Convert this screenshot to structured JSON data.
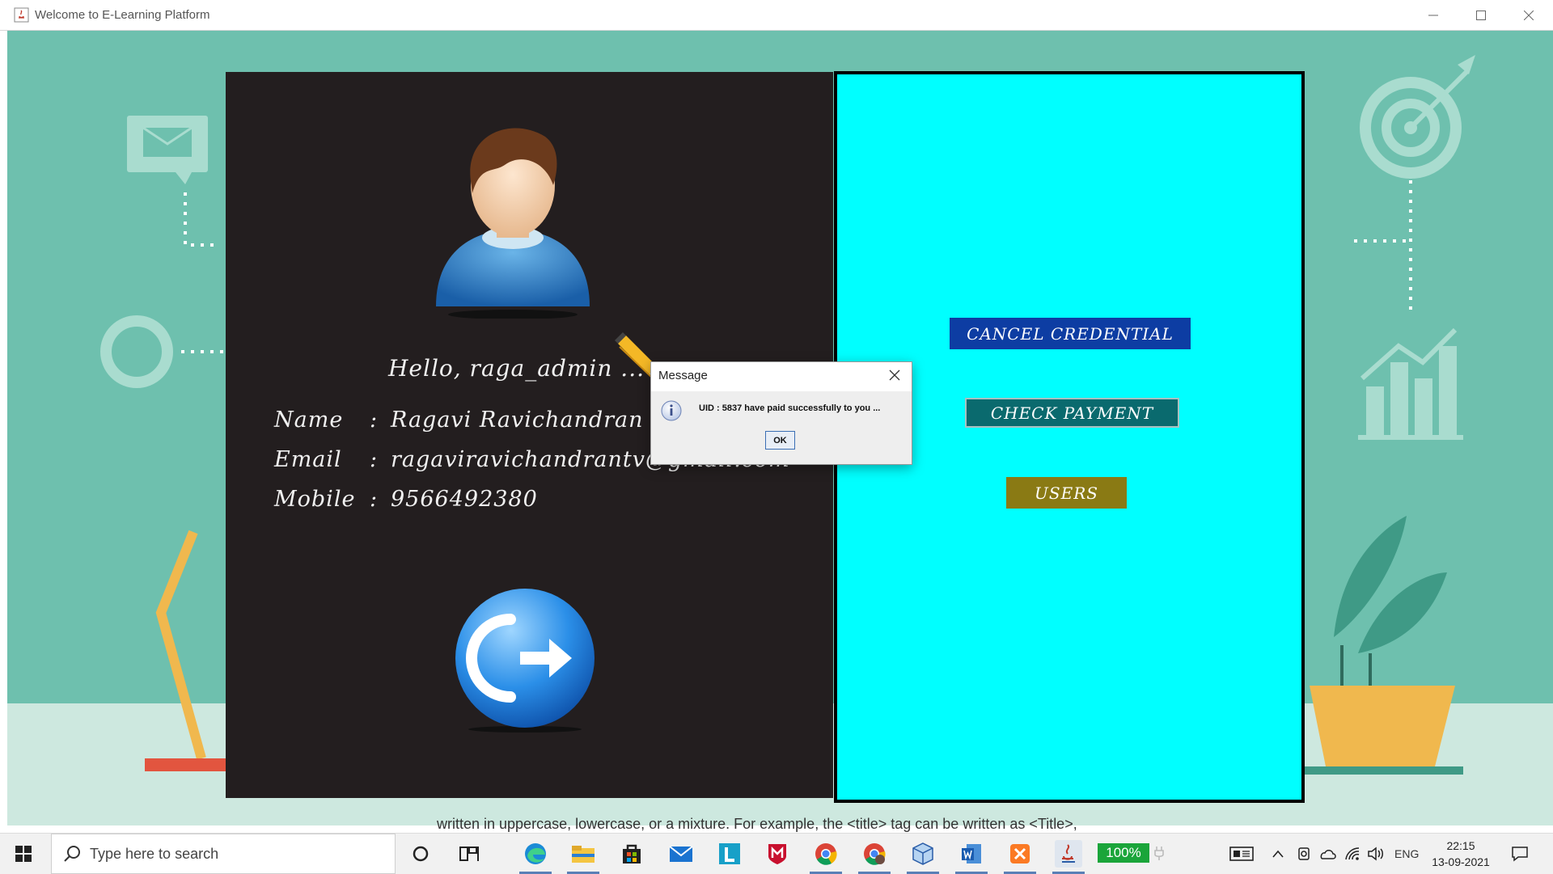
{
  "window": {
    "title": "Welcome to E-Learning Platform",
    "controls": [
      "minimize",
      "maximize",
      "close"
    ]
  },
  "profile": {
    "greeting": "Hello, raga_admin ...",
    "name_label": "Name",
    "name_value": "Ragavi Ravichandran",
    "email_label": "Email",
    "email_value": "ragaviravichandrantv@gmail.com",
    "mobile_label": "Mobile",
    "mobile_value": "9566492380",
    "separator": ":"
  },
  "actions": {
    "cancel_credential": "CANCEL CREDENTIAL",
    "check_payment": "CHECK PAYMENT",
    "users": "USERS"
  },
  "dialog": {
    "title": "Message",
    "message": "UID  :  5837  have paid successfully to you ...",
    "ok": "OK",
    "icon": "info-icon"
  },
  "background_text": "written in uppercase, lowercase, or a mixture. For example, the <title> tag can be written as <Title>,",
  "taskbar": {
    "search_placeholder": "Type here to search",
    "battery": "100%",
    "language": "ENG",
    "time": "22:15",
    "date": "13-09-2021",
    "apps": [
      "task-view-icon",
      "edge-icon",
      "file-explorer-icon",
      "store-icon",
      "mail-icon",
      "l-app-icon",
      "mcafee-icon",
      "chrome-icon",
      "chrome-profile-icon",
      "virtualbox-icon",
      "word-icon",
      "xampp-icon",
      "java-icon"
    ]
  },
  "colors": {
    "left_panel": "#231e1f",
    "right_panel": "#00ffff",
    "cancel_button": "#0d3da3",
    "check_button": "#0a6a6e",
    "users_button": "#8a7a14",
    "scene": "#6ec0ae"
  }
}
